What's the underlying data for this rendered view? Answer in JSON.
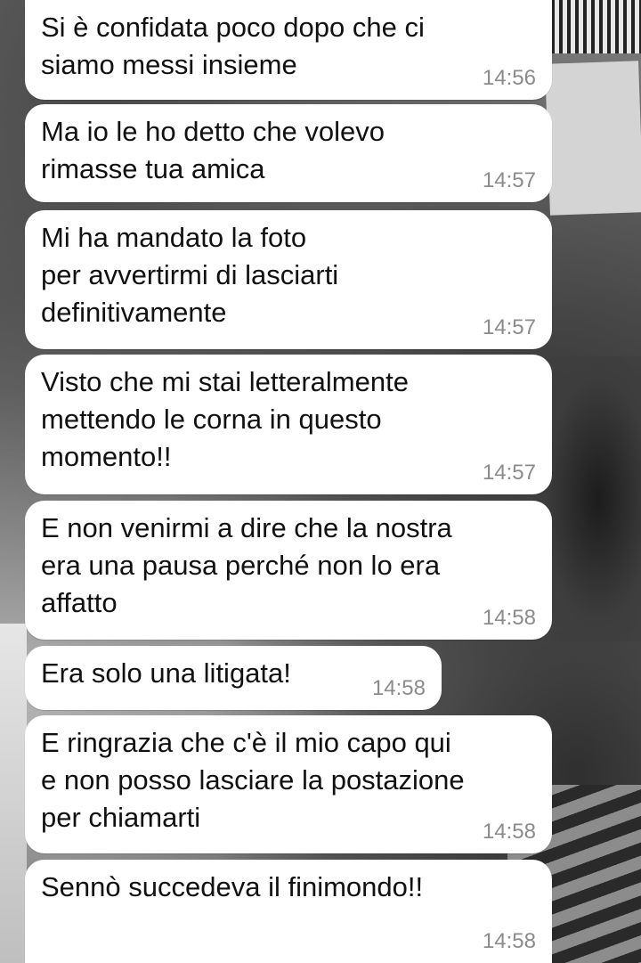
{
  "chat": {
    "messages": [
      {
        "text": "Si è confidata poco dopo che ci\nsiamo messi insieme",
        "time": "14:56"
      },
      {
        "text": "Ma io le ho detto che volevo\nrimasse tua amica",
        "time": "14:57"
      },
      {
        "text": "Mi ha mandato la foto\nper avvertirmi di lasciarti\ndefinitivamente",
        "time": "14:57"
      },
      {
        "text": "Visto che mi stai letteralmente\nmettendo le corna in questo\nmomento!!",
        "time": "14:57"
      },
      {
        "text": "E non venirmi a dire che la nostra\nera una pausa perché non lo era\naffatto",
        "time": "14:58"
      },
      {
        "text": "Era solo una litigata!",
        "time": "14:58"
      },
      {
        "text": "E ringrazia che c'è il mio capo qui\ne non posso lasciare la postazione\nper chiamarti",
        "time": "14:58"
      },
      {
        "text": "Sennò succedeva il finimondo!!",
        "time": "14:58"
      }
    ]
  },
  "colors": {
    "bubble": "#ffffff",
    "text": "#111111",
    "timestamp": "#8b8b8b"
  }
}
